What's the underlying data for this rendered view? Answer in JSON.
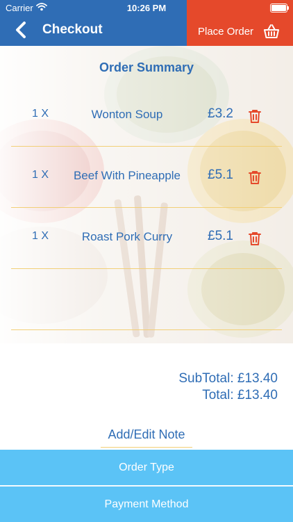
{
  "status_bar": {
    "carrier": "Carrier",
    "time": "10:26 PM"
  },
  "nav": {
    "title": "Checkout",
    "place_order": "Place Order"
  },
  "summary_title": "Order Summary",
  "items": [
    {
      "qty": "1 X",
      "name": "Wonton Soup",
      "price": "£3.2"
    },
    {
      "qty": "1 X",
      "name": "Beef With Pineapple",
      "price": "£5.1"
    },
    {
      "qty": "1 X",
      "name": "Roast Pork Curry",
      "price": "£5.1"
    }
  ],
  "totals": {
    "subtotal": "SubTotal: £13.40",
    "total": "Total: £13.40"
  },
  "note_label": "Add/Edit Note",
  "buttons": {
    "order_type": "Order Type",
    "payment_method": "Payment Method"
  },
  "colors": {
    "nav_blue": "#2f6db5",
    "place_order_red": "#e5492b",
    "text_blue": "#2f6db5",
    "divider": "#f2cf76",
    "button_blue": "#5bc3f6"
  }
}
